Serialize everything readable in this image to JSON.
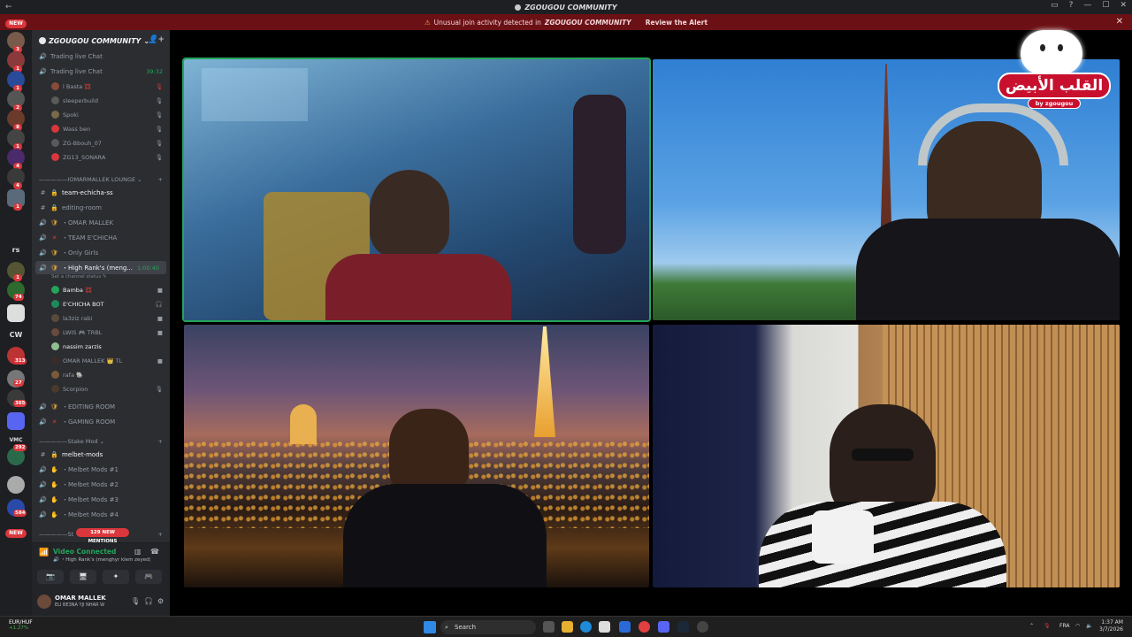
{
  "titlebar": {
    "title": "ZGOUGOU COMMUNITY",
    "back": "←",
    "controls": [
      "▭",
      "?",
      "—",
      "☐",
      "✕"
    ]
  },
  "alert": {
    "icon": "⚠",
    "text": "Unusual join activity detected in",
    "server": "ZGOUGOU COMMUNITY",
    "action": "Review the Alert",
    "close": "✕"
  },
  "rail": {
    "new_top": "NEW",
    "badges": [
      "3",
      "1",
      "1",
      "2",
      "8",
      "1",
      "4",
      "4",
      "1",
      "1",
      "74",
      "313",
      "27",
      "365",
      "292",
      "584"
    ],
    "labels": [
      "rs",
      "CW",
      "VMC"
    ],
    "new_bottom": "NEW"
  },
  "server": {
    "name": "ZGOUGOU COMMUNITY",
    "chevron": "⌄",
    "invite_icon": "👤+"
  },
  "channels": {
    "trading_1": "Trading live Chat",
    "trading_2": "Trading live Chat",
    "trading_2_time": "39:32",
    "trading_users": [
      "l Basta 💢",
      "sleeperbuild",
      "Spoki",
      "Wass ben",
      "ZG-Bbouh_07",
      "ZG13_SONARA"
    ],
    "cat_1": "—————IOMARMALLEK LOUNGE ⌄",
    "team_echicha_ss": "team-echicha-ss",
    "editing_room": "editing-room",
    "omar_mallek": "・OMAR MALLEK",
    "team_echicha": "・TEAM E'CHICHA",
    "only_girls": "・Only Girls",
    "high_ranks": "・High Rank's (meng...",
    "high_ranks_time": "1:00:40",
    "status_hint": "Set a channel status ✎",
    "high_users": [
      "Bamba 💢",
      "E'CHICHA BOT",
      "la3ziz rabi",
      "LWIS 🎮 TRBL",
      "nassim zarzis",
      "OMAR MALLEK 👑 TL",
      "rafa 🐘",
      "Scorpion"
    ],
    "editing_room_voice": "・EDITING ROOM",
    "gaming_room": "・GAMING ROOM",
    "cat_2": "—————Stake Mod ⌄",
    "melbet_mods": "melbet-mods",
    "melbet_1": "・Melbet Mods #1",
    "melbet_2": "・Melbet Mods #2",
    "melbet_3": "・Melbet Mods #3",
    "melbet_4": "・Melbet Mods #4",
    "cat_3": "—————St",
    "new_mentions": "129 NEW MENTIONS"
  },
  "voice": {
    "status": "Video Connected",
    "channel": "🔊 ・High Rank's (menghyr klem zeyed) / ...",
    "buttons": [
      "📷",
      "🖥",
      "✦",
      "🎮"
    ]
  },
  "user": {
    "name": "OMAR MALLEK",
    "status": "ELI BE3NA YJI NHAR W"
  },
  "logo": {
    "arabic": "القلب الأبيض",
    "by": "by zgougou"
  },
  "taskbar": {
    "ticker_name": "EUR/HUF",
    "ticker_change": "+1.27%",
    "search": "Search",
    "lang": "FRA",
    "time": "1:37 AM",
    "date": "3/7/2026"
  },
  "colors": {
    "accent_green": "#23a55a",
    "alert_red": "#6b1116",
    "badge_red": "#da373c",
    "brand_red": "#c8102e"
  }
}
